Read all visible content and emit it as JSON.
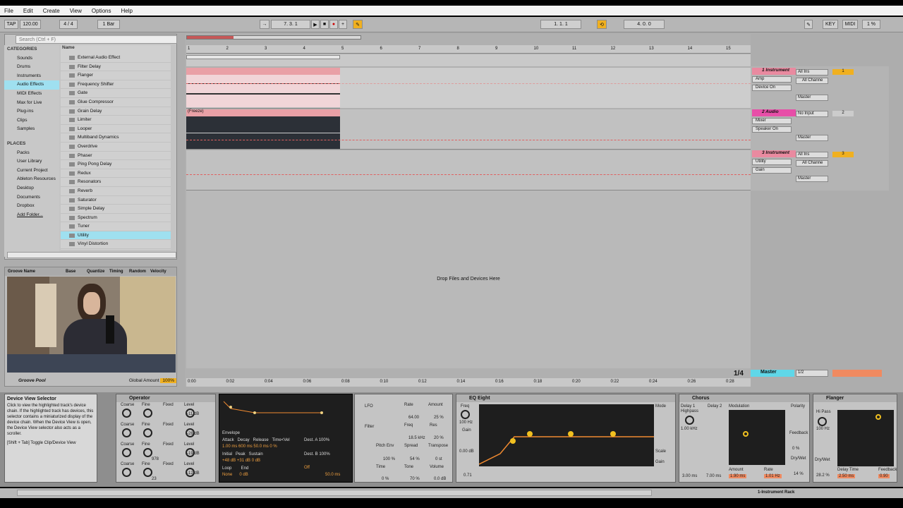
{
  "menu": [
    "File",
    "Edit",
    "Create",
    "View",
    "Options",
    "Help"
  ],
  "transport": {
    "tap": "TAP",
    "tempo": "120.00",
    "sig": "4 / 4",
    "quant": "1 Bar",
    "position": "7.   3.   1",
    "loop_start": "1.   1.   1",
    "loop_len": "4.   0.   0",
    "key": "KEY",
    "midi": "MIDI",
    "cpu": "1 %"
  },
  "browser": {
    "search_placeholder": "Search (Ctrl + F)",
    "categories_header": "CATEGORIES",
    "name_header": "Name",
    "categories": [
      "Sounds",
      "Drums",
      "Instruments",
      "Audio Effects",
      "MIDI Effects",
      "Max for Live",
      "Plug-ins",
      "Clips",
      "Samples"
    ],
    "places_header": "PLACES",
    "places": [
      "Packs",
      "User Library",
      "Current Project",
      "Ableton Resources",
      "Desktop",
      "Documents",
      "Dropbox",
      "Add Folder..."
    ],
    "items": [
      "External Audio Effect",
      "Filter Delay",
      "Flanger",
      "Frequency Shifter",
      "Gate",
      "Glue Compressor",
      "Grain Delay",
      "Limiter",
      "Looper",
      "Multiband Dynamics",
      "Overdrive",
      "Phaser",
      "Ping Pong Delay",
      "Redux",
      "Resonators",
      "Reverb",
      "Saturator",
      "Simple Delay",
      "Spectrum",
      "Tuner",
      "Utility",
      "Vinyl Distortion"
    ]
  },
  "groove": {
    "cols": [
      "Groove Name",
      "Base",
      "Quantize",
      "Timing",
      "Random",
      "Velocity"
    ],
    "pool": "Groove Pool",
    "global": "Global Amount",
    "global_val": "100%"
  },
  "arrangement": {
    "bars": [
      "1",
      "2",
      "3",
      "4",
      "5",
      "6",
      "7",
      "8",
      "9",
      "10",
      "11",
      "12",
      "13",
      "14",
      "15"
    ],
    "freeze": "(Freeze)",
    "drop": "Drop Files and Devices Here",
    "times": [
      "0:00",
      "0:02",
      "0:04",
      "0:06",
      "0:08",
      "0:10",
      "0:12",
      "0:14",
      "0:16",
      "0:18",
      "0:20",
      "0:22",
      "0:24",
      "0:26",
      "0:28"
    ],
    "zoom": "1/4"
  },
  "tracks": [
    {
      "name": "1 Instrument",
      "input": "All Ins",
      "ch": "All Channe",
      "dev1": "Amp",
      "dev2": "Device On",
      "out": "Master",
      "num": "1"
    },
    {
      "name": "2 Audio",
      "input": "No Input",
      "dev1": "Mixer",
      "dev2": "Speaker On",
      "out": "Master",
      "num": "2"
    },
    {
      "name": "3 Instrument",
      "input": "All Ins",
      "ch": "All Channe",
      "dev1": "Utility",
      "dev2": "Gain",
      "out": "Master",
      "num": "3"
    }
  ],
  "master": {
    "name": "Master",
    "io": "1/2"
  },
  "info": {
    "title": "Device View Selector",
    "body": "Click to view the highlighted track's device chain. If the highlighted track has devices, this selector contains a miniaturized display of the device chain. When the Device View is open, the Device View selector also acts as a scroller.",
    "shortcut": "[Shift + Tab] Toggle Clip/Device View"
  },
  "devices": {
    "operator": "Operator",
    "eq": "EQ Eight",
    "chorus": "Chorus",
    "flanger": "Flanger",
    "op_rows": [
      {
        "lvl": "-11 dB"
      },
      {
        "lvl": "-28 dB"
      },
      {
        "lvl": "-19 dB",
        "fine": "978"
      },
      {
        "lvl": "-12 dB",
        "fine": "23"
      }
    ],
    "op_labels": [
      "Coarse",
      "Fine",
      "Fixed",
      "Level"
    ],
    "env": {
      "attack": "1.00 ms",
      "decay": "600 ms",
      "release": "50.0 ms",
      "time_vel": "0 %",
      "initial": "+48 dB",
      "peak": "+31 dB",
      "sustain": "0 dB",
      "loop": "None",
      "end": "0 dB",
      "dest_a": "100%",
      "dest_b": "100%",
      "glide": "Off",
      "time": "50.0 ms"
    },
    "lfo": {
      "rate": "64.00",
      "amount": "25 %",
      "freq": "18.5 kHz",
      "res": "20 %",
      "pitch": "100 %",
      "spread": "54 %",
      "transpose": "0 st",
      "time": "0 %",
      "tone": "70 %",
      "volume": "0.0 dB"
    },
    "eq_freq": "100 Hz",
    "eq_gain": "0.00 dB",
    "eq_q": "0.71",
    "chorus_vals": {
      "highpass": "1.00 kHz",
      "d1": "3.00 ms",
      "d2": "7.00 ms",
      "amount": "1.90 ms",
      "rate": "1.01 Hz",
      "feedback": "0 %",
      "drywet": "14 %",
      "gain": "0.00 dB",
      "scale": "100 %"
    },
    "flanger_vals": {
      "hipass": "100 Hz",
      "drywet": "28.2 %",
      "delay": "2.50 ms",
      "feedback": "0.90"
    }
  },
  "status": {
    "rack": "1-Instrument Rack"
  }
}
